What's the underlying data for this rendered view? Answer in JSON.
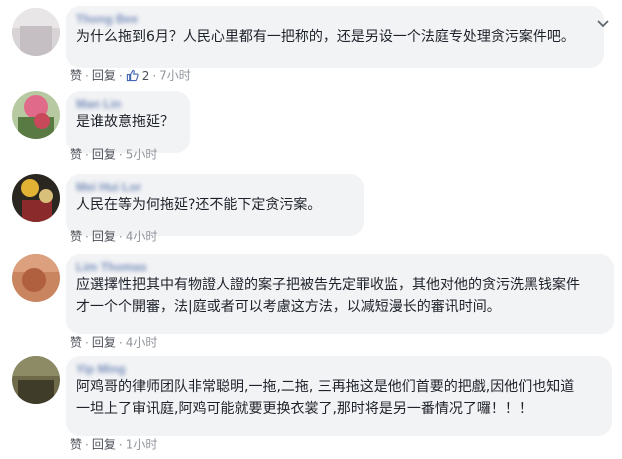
{
  "comments": [
    {
      "author": "Thong Bee",
      "text": [
        "为什么拖到6月？人民心里都有一把称的，还是另设一个法庭专处理贪污案件吧。"
      ],
      "like": "赞",
      "reply": "回复",
      "reactions": "2",
      "time": "7小时"
    },
    {
      "author": "Man Lin",
      "text": [
        "是谁故意拖延？"
      ],
      "like": "赞",
      "reply": "回复",
      "time": "5小时"
    },
    {
      "author": "Mei Hui Lor",
      "text": [
        "人民在等为何拖延?还不能下定贪污案。"
      ],
      "like": "赞",
      "reply": "回复",
      "time": "4小时"
    },
    {
      "author": "Lim Thomas",
      "text": [
        "应選擇性把其中有物證人證的案子把被告先定罪收监，其他对他的贪污洗黑钱案件",
        "才一个个開審，法|庭或者可以考慮这方法，以减短漫长的審讯时间。"
      ],
      "like": "赞",
      "reply": "回复",
      "time": "4小时"
    },
    {
      "author": "Yip Ming",
      "text": [
        "阿鸡哥的律师团队非常聪明,一拖,二拖, 三再拖这是他们首要的把戲,因他们也知道",
        "一坦上了审讯庭,阿鸡可能就要更换衣裳了,那时将是另一番情况了囉！！！"
      ],
      "like": "赞",
      "reply": "回复",
      "time": "1小时"
    }
  ],
  "icons": {
    "thumb": "thumbs-up-icon",
    "menu": "chevron-down-icon"
  },
  "colors": {
    "bubble": "#f2f3f5",
    "author": "#365899",
    "meta": "#90949c",
    "reaction": "#4267b2"
  }
}
